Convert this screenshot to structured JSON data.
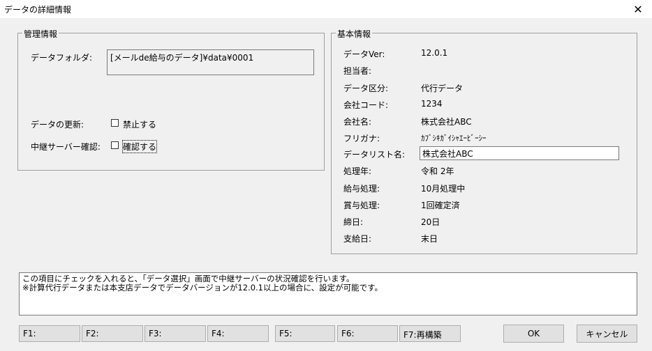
{
  "window": {
    "title": "データの詳細情報"
  },
  "management": {
    "legend": "管理情報",
    "folder_label": "データフォルダ:",
    "folder_value": "[メールde給与のデータ]¥data¥0001",
    "update_label": "データの更新:",
    "update_checkbox_label": "禁止する",
    "relay_label": "中継サーバー確認:",
    "relay_checkbox_label": "確認する"
  },
  "basic": {
    "legend": "基本情報",
    "rows": [
      {
        "label": "データVer:",
        "value": "12.0.1"
      },
      {
        "label": "担当者:",
        "value": ""
      },
      {
        "label": "データ区分:",
        "value": "代行データ"
      },
      {
        "label": "会社コード:",
        "value": "1234"
      },
      {
        "label": "会社名:",
        "value": "株式会社ABC"
      },
      {
        "label": "フリガナ:",
        "value": "ｶﾌﾞｼｷｶﾞｲｼｬｴｰﾋﾞｰｼｰ"
      },
      {
        "label": "データリスト名:",
        "value": "株式会社ABC"
      },
      {
        "label": "処理年:",
        "value": "令和 2年"
      },
      {
        "label": "給与処理:",
        "value": "10月処理中"
      },
      {
        "label": "賞与処理:",
        "value": "1回確定済"
      },
      {
        "label": "締日:",
        "value": "20日"
      },
      {
        "label": "支給日:",
        "value": "末日"
      }
    ]
  },
  "info": {
    "line1": "この項目にチェックを入れると、「データ選択」画面で中継サーバーの状況確認を行います。",
    "line2": "※計算代行データまたは本支店データでデータバージョンが12.0.1以上の場合に、設定が可能です。"
  },
  "fkeys": [
    "F1:",
    "F2:",
    "F3:",
    "F4:",
    "F5:",
    "F6:",
    "F7:再構築"
  ],
  "buttons": {
    "ok": "OK",
    "cancel": "キャンセル"
  }
}
